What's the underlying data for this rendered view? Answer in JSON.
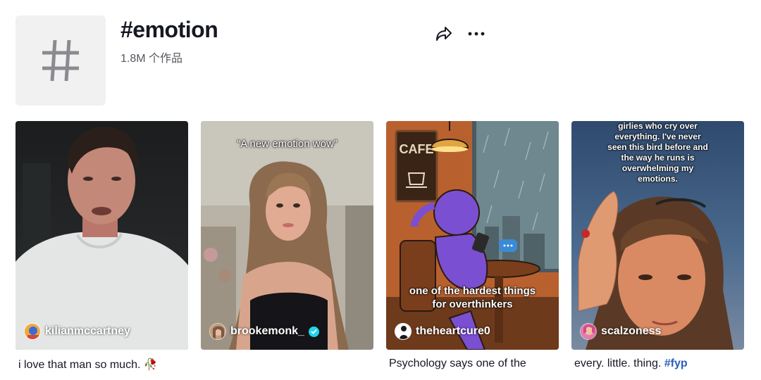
{
  "tag": {
    "title": "#emotion",
    "count": "1.8M 个作品",
    "icon": "hashtag-icon"
  },
  "actions": {
    "share_icon": "share-icon",
    "more_icon": "more-dots-icon"
  },
  "videos": [
    {
      "author": "kilianmccartney",
      "caption": "i love that man so much. 🥀",
      "overlay": ""
    },
    {
      "author": "brookemonk_",
      "verified": true,
      "caption": "",
      "overlay": "“A new emotion wow”"
    },
    {
      "author": "theheartcure0",
      "caption": "Psychology says one of the",
      "overlay_lines": [
        "one of the hardest things",
        "for overthinkers"
      ],
      "sign": "CAFE"
    },
    {
      "author": "scalzoness",
      "caption": "every. little. thing.",
      "caption_tag": "#fyp",
      "overlay_lines": [
        "girlies who cry over",
        "everything.  I've never",
        "seen this bird before and",
        "the way he runs is",
        "overwhelming my",
        "emotions."
      ]
    }
  ],
  "colors": {
    "text": "#161823",
    "secondary": "#57575f",
    "hashtag": "#2b5db9",
    "verified": "#20d5ec"
  }
}
